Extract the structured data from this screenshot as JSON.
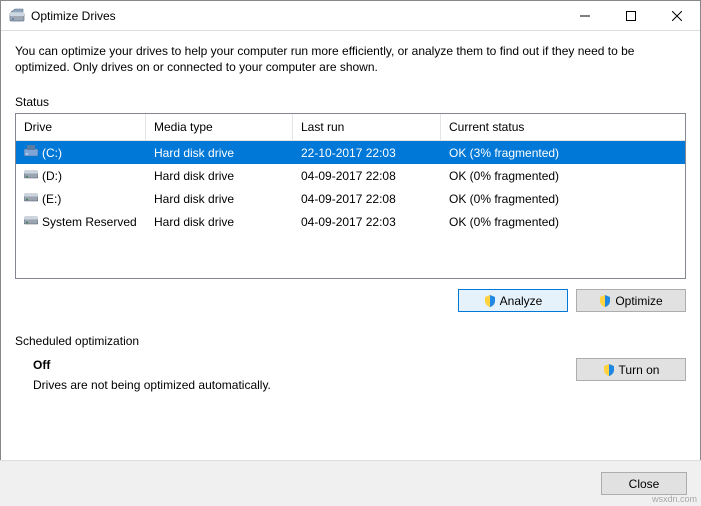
{
  "window": {
    "title": "Optimize Drives"
  },
  "description": "You can optimize your drives to help your computer run more efficiently, or analyze them to find out if they need to be optimized. Only drives on or connected to your computer are shown.",
  "status_label": "Status",
  "columns": {
    "drive": "Drive",
    "media": "Media type",
    "last": "Last run",
    "status": "Current status"
  },
  "rows": [
    {
      "drive": "(C:)",
      "media": "Hard disk drive",
      "last": "22-10-2017 22:03",
      "status": "OK (3% fragmented)",
      "selected": true,
      "system": true
    },
    {
      "drive": "(D:)",
      "media": "Hard disk drive",
      "last": "04-09-2017 22:08",
      "status": "OK (0% fragmented)",
      "selected": false,
      "system": false
    },
    {
      "drive": "(E:)",
      "media": "Hard disk drive",
      "last": "04-09-2017 22:08",
      "status": "OK (0% fragmented)",
      "selected": false,
      "system": false
    },
    {
      "drive": "System Reserved",
      "media": "Hard disk drive",
      "last": "04-09-2017 22:03",
      "status": "OK (0% fragmented)",
      "selected": false,
      "system": false
    }
  ],
  "buttons": {
    "analyze": "Analyze",
    "optimize": "Optimize",
    "turn_on": "Turn on",
    "close": "Close"
  },
  "sched": {
    "label": "Scheduled optimization",
    "state": "Off",
    "sub": "Drives are not being optimized automatically."
  },
  "watermark": "wsxdn.com"
}
